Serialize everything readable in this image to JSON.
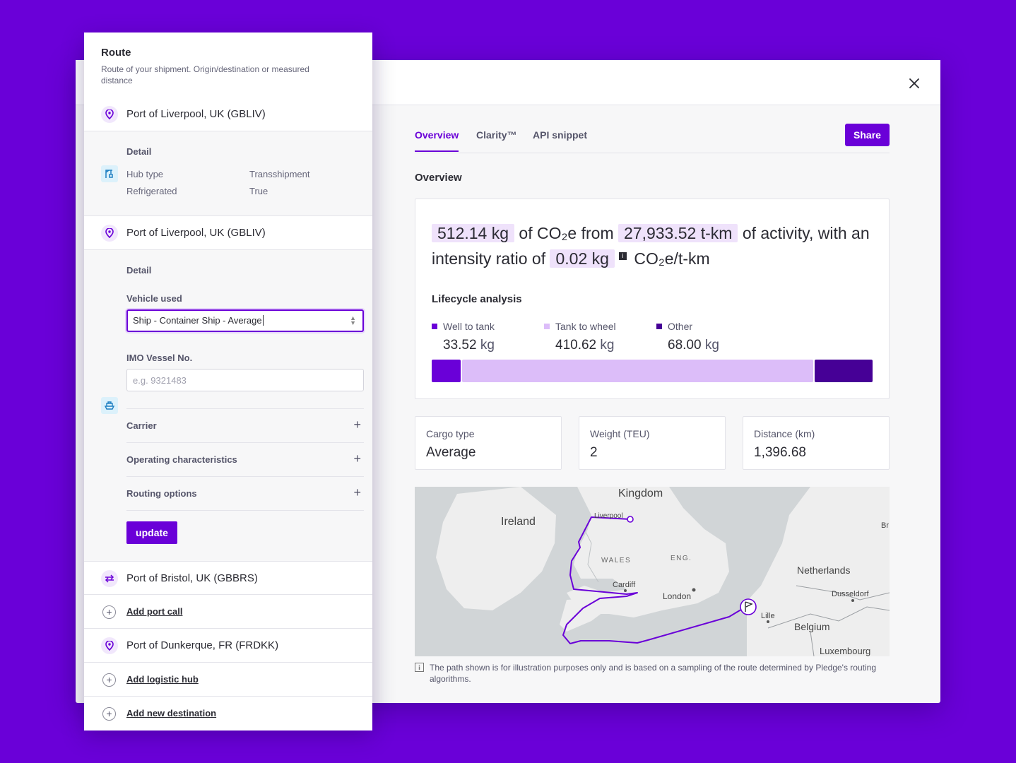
{
  "modal": {
    "tabs": [
      {
        "label": "Overview",
        "active": true
      },
      {
        "label": "Clarity™",
        "active": false
      },
      {
        "label": "API snippet",
        "active": false
      }
    ],
    "share_label": "Share",
    "section_title": "Overview",
    "summary": {
      "emissions": "512.14 kg",
      "t1": "of CO₂e from",
      "activity": "27,933.52 t-km",
      "t2": "of activity, with an intensity ratio of",
      "intensity": "0.02 kg",
      "t3": "CO₂e/t-km"
    },
    "lifecycle": {
      "title": "Lifecycle analysis",
      "items": [
        {
          "label": "Well to tank",
          "value": "33.52",
          "unit": "kg",
          "color": "#6a00d8"
        },
        {
          "label": "Tank to wheel",
          "value": "410.62",
          "unit": "kg",
          "color": "#dcbdf9"
        },
        {
          "label": "Other",
          "value": "68.00",
          "unit": "kg",
          "color": "#460096"
        }
      ]
    },
    "metrics": [
      {
        "label": "Cargo type",
        "value": "Average"
      },
      {
        "label": "Weight (TEU)",
        "value": "2"
      },
      {
        "label": "Distance (km)",
        "value": "1,396.68"
      }
    ],
    "map": {
      "labels": {
        "kingdom": "Kingdom",
        "ireland": "Ireland",
        "liverpool": "Liverpool",
        "wales": "WALES",
        "eng": "ENG.",
        "cardiff": "Cardiff",
        "london": "London",
        "netherlands": "Netherlands",
        "dusseldorf": "Dusseldorf",
        "lille": "Lille",
        "belgium": "Belgium",
        "luxembourg": "Luxembourg",
        "br": "Br"
      },
      "route_color": "#6a00d8"
    },
    "disclaimer": "The path shown is for illustration purposes only and is based on a sampling of the route determined by Pledge's routing algorithms."
  },
  "panel": {
    "title": "Route",
    "subtitle": "Route of your shipment. Origin/destination or measured distance",
    "stop1": "Port of Liverpool, UK (GBLIV)",
    "hub_detail": {
      "heading": "Detail",
      "rows": [
        {
          "key": "Hub type",
          "value": "Transshipment"
        },
        {
          "key": "Refrigerated",
          "value": "True"
        }
      ]
    },
    "stop2": "Port of Liverpool, UK (GBLIV)",
    "leg_detail": {
      "heading": "Detail",
      "vehicle_label": "Vehicle used",
      "vehicle_value": "Ship - Container Ship - Average",
      "imo_label": "IMO Vessel No.",
      "imo_placeholder": "e.g. 9321483",
      "accordions": [
        "Carrier",
        "Operating characteristics",
        "Routing options"
      ],
      "update_label": "update"
    },
    "stop3": "Port of Bristol, UK (GBBRS)",
    "add_port_call": "Add port call",
    "stop4": "Port of Dunkerque, FR (FRDKK)",
    "add_hub": "Add logistic hub",
    "add_destination": "Add new destination"
  }
}
